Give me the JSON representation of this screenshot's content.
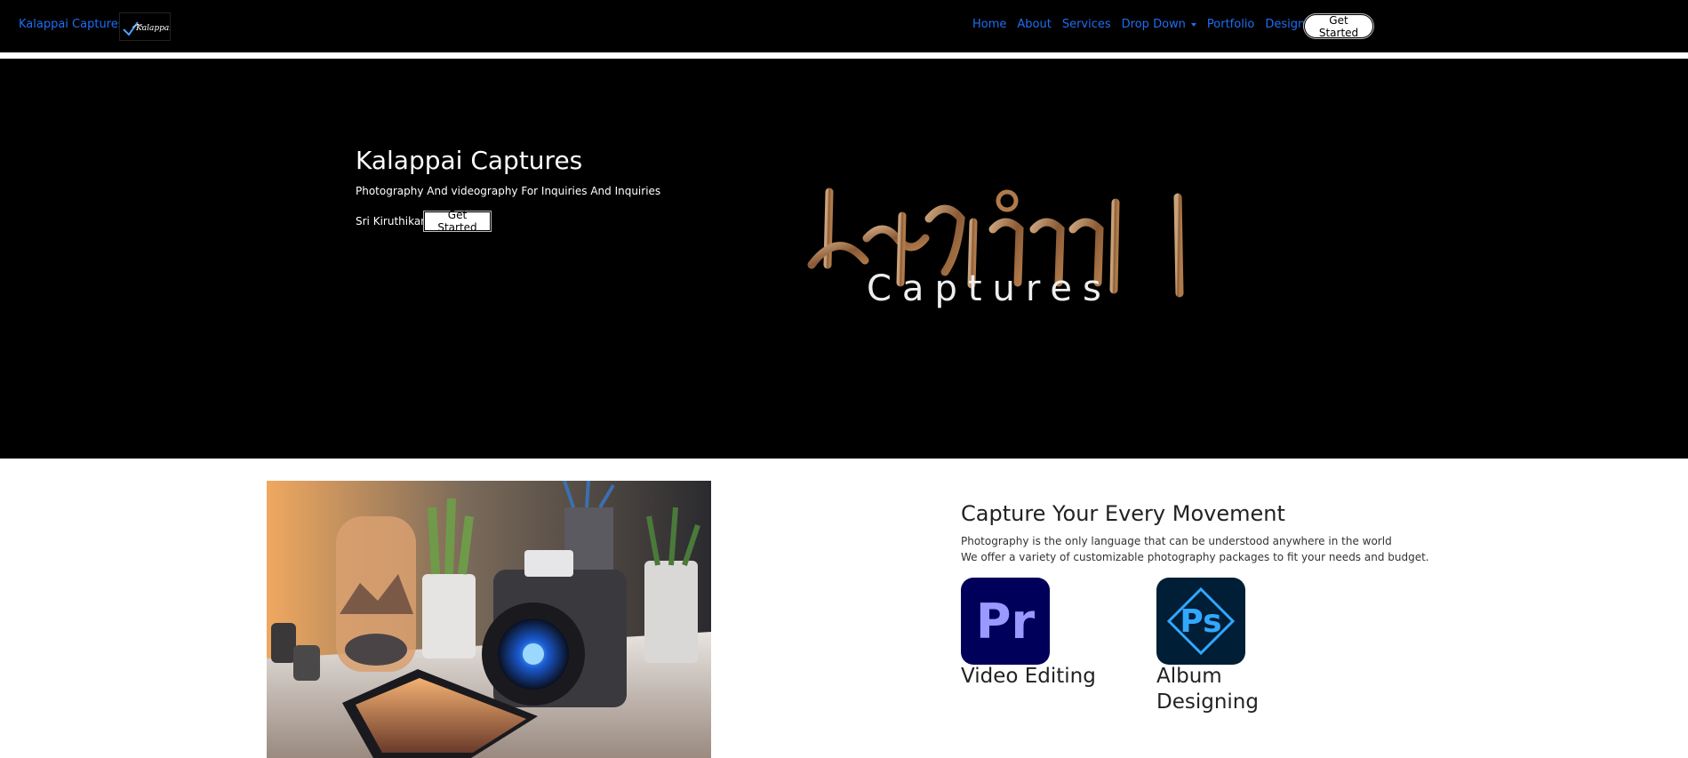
{
  "navbar": {
    "brand": "Kalappai Captures",
    "links": [
      {
        "label": "Home"
      },
      {
        "label": "About"
      },
      {
        "label": "Services"
      },
      {
        "label": "Drop Down"
      },
      {
        "label": "Portfolio"
      },
      {
        "label": "Designs"
      }
    ],
    "cta": "Get Started"
  },
  "hero": {
    "title": "Kalappai Captures",
    "subtitle": "Photography And videography For Inquiries And Inquiries",
    "author": "Sri Kiruthikan",
    "cta": "Get Started",
    "logo_text": "Captures"
  },
  "content": {
    "heading": "Capture Your Every Movement",
    "lines": [
      "Photography is the only language that can be understood anywhere in the world",
      "We offer a variety of customizable photography packages to fit your needs and budget."
    ],
    "services": [
      {
        "icon_text": "Pr",
        "label_line1": "Video Editing",
        "label_line2": ""
      },
      {
        "icon_text": "Ps",
        "label_line1": "Album",
        "label_line2": "Designing"
      }
    ]
  },
  "colors": {
    "link": "#1e6ef5",
    "pr_bg": "#00005b",
    "pr_fg": "#9999ff",
    "ps_bg": "#001e36",
    "ps_fg": "#31a8ff"
  }
}
